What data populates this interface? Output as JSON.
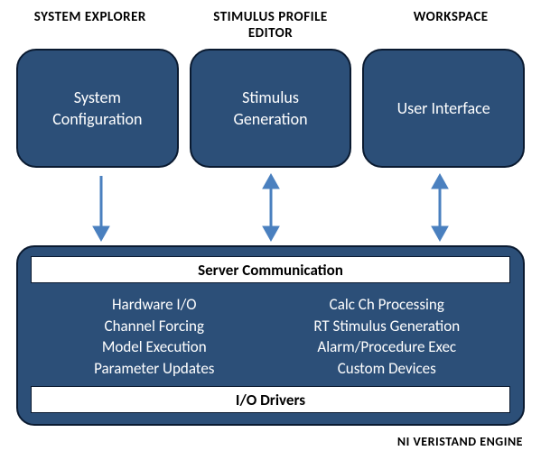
{
  "headers": {
    "system_explorer": "SYSTEM EXPLORER",
    "stimulus_profile_editor": "STIMULUS PROFILE\nEDITOR",
    "workspace": "WORKSPACE"
  },
  "top_boxes": {
    "system_configuration": "System\nConfiguration",
    "stimulus_generation": "Stimulus\nGeneration",
    "user_interface": "User Interface"
  },
  "arrows": {
    "a1": "down",
    "a2": "bidirectional",
    "a3": "bidirectional"
  },
  "server": {
    "top_band": "Server Communication",
    "features_left": {
      "f1": "Hardware I/O",
      "f2": "Channel Forcing",
      "f3": "Model  Execution",
      "f4": "Parameter Updates"
    },
    "features_right": {
      "f1": "Calc Ch Processing",
      "f2": "RT Stimulus Generation",
      "f3": "Alarm/Procedure Exec",
      "f4": "Custom Devices"
    },
    "bottom_band": "I/O Drivers"
  },
  "engine_label": "NI VERISTAND ENGINE",
  "colors": {
    "box_fill": "#2c4f78",
    "box_border": "#0a1a30",
    "arrow": "#4a80bf"
  }
}
